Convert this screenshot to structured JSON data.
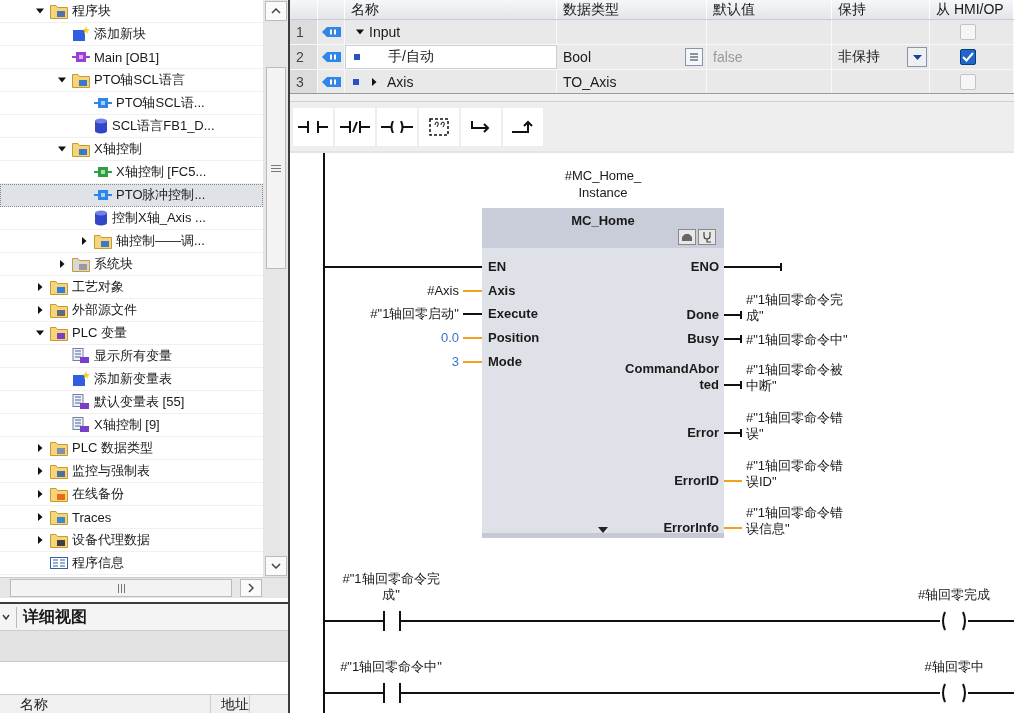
{
  "project_tree": {
    "items": [
      {
        "label": "程序块",
        "kind": "program_blocks",
        "expanded": true,
        "selected": false,
        "children": [
          {
            "label": "添加新块",
            "kind": "add_block",
            "selected": false
          },
          {
            "label": "Main [OB1]",
            "kind": "ob",
            "selected": false
          },
          {
            "label": "PTO轴SCL语言",
            "kind": "group",
            "expanded": true,
            "selected": false,
            "children": [
              {
                "label": "PTO轴SCL语...",
                "kind": "fb",
                "selected": false
              },
              {
                "label": "SCL语言FB1_D...",
                "kind": "db",
                "selected": false
              }
            ]
          },
          {
            "label": "X轴控制",
            "kind": "group",
            "expanded": true,
            "selected": false,
            "children": [
              {
                "label": "X轴控制 [FC5...",
                "kind": "fc",
                "selected": false
              },
              {
                "label": "PTO脉冲控制...",
                "kind": "fb",
                "selected": true
              },
              {
                "label": "控制X轴_Axis ...",
                "kind": "db",
                "selected": false
              },
              {
                "label": "轴控制——调...",
                "kind": "group",
                "expanded": false,
                "selected": false
              }
            ]
          },
          {
            "label": "系统块",
            "kind": "system_blocks",
            "expanded": false,
            "selected": false
          }
        ]
      },
      {
        "label": "工艺对象",
        "kind": "technology_objects",
        "expanded": false,
        "selected": false
      },
      {
        "label": "外部源文件",
        "kind": "external_sources",
        "expanded": false,
        "selected": false
      },
      {
        "label": "PLC 变量",
        "kind": "plc_tags",
        "expanded": true,
        "selected": false,
        "children": [
          {
            "label": "显示所有变量",
            "kind": "show_tags",
            "selected": false
          },
          {
            "label": "添加新变量表",
            "kind": "add_table",
            "selected": false
          },
          {
            "label": "默认变量表 [55]",
            "kind": "tag_table",
            "selected": false
          },
          {
            "label": "X轴控制 [9]",
            "kind": "tag_table",
            "selected": false
          }
        ]
      },
      {
        "label": "PLC 数据类型",
        "kind": "data_types",
        "expanded": false,
        "selected": false
      },
      {
        "label": "监控与强制表",
        "kind": "watch_tables",
        "expanded": false,
        "selected": false
      },
      {
        "label": "在线备份",
        "kind": "online_backups",
        "expanded": false,
        "selected": false
      },
      {
        "label": "Traces",
        "kind": "traces",
        "expanded": false,
        "selected": false
      },
      {
        "label": "设备代理数据",
        "kind": "device_proxy",
        "expanded": false,
        "selected": false
      },
      {
        "label": "程序信息",
        "kind": "program_info",
        "selected": false
      }
    ]
  },
  "details_view": {
    "title": "详细视图",
    "columns": [
      "名称",
      "地址"
    ]
  },
  "interface_table": {
    "columns": [
      "名称",
      "数据类型",
      "默认值",
      "保持",
      "从 HMI/OP"
    ],
    "rows": [
      {
        "number": "1",
        "kind": "section",
        "name": "Input",
        "expanded": true,
        "selected": false,
        "hmi_accessible": false
      },
      {
        "number": "2",
        "kind": "parameter",
        "name": "手/自动",
        "data_type": "Bool",
        "default_value": "false",
        "retain": "非保持",
        "selected": true,
        "hmi_accessible": true
      },
      {
        "number": "3",
        "kind": "parameter",
        "name": "Axis",
        "expanded": false,
        "data_type": "TO_Axis",
        "selected": false,
        "hmi_accessible": false
      }
    ]
  },
  "ladder": {
    "block": {
      "instance": "#MC_Home_Instance",
      "name": "MC_Home",
      "inputs": [
        {
          "pin": "EN",
          "boolean": true
        },
        {
          "pin": "Axis",
          "operand": "#Axis",
          "constant": false,
          "boolean": false
        },
        {
          "pin": "Execute",
          "operand": "#\"1轴回零启动\"",
          "constant": false,
          "boolean": true
        },
        {
          "pin": "Position",
          "operand": "0.0",
          "constant": true,
          "boolean": false
        },
        {
          "pin": "Mode",
          "operand": "3",
          "constant": true,
          "boolean": false
        }
      ],
      "outputs": [
        {
          "pin": "ENO",
          "boolean": true
        },
        {
          "pin": "Done",
          "operand": "#\"1轴回零命令完成\"",
          "boolean": true
        },
        {
          "pin": "Busy",
          "operand": "#\"1轴回零命令中\"",
          "boolean": true
        },
        {
          "pin": "CommandAborted",
          "operand": "#\"1轴回零命令被中断\"",
          "boolean": true
        },
        {
          "pin": "Error",
          "operand": "#\"1轴回零命令错误\"",
          "boolean": true
        },
        {
          "pin": "ErrorID",
          "operand": "#\"1轴回零命令错误ID\"",
          "boolean": false
        },
        {
          "pin": "ErrorInfo",
          "operand": "#\"1轴回零命令错误信息\"",
          "boolean": false
        }
      ]
    },
    "networks": [
      {
        "contact": "#\"1轴回零命令完成\"",
        "coil": "#轴回零完成"
      },
      {
        "contact": "#\"1轴回零命令中\"",
        "coil": "#轴回零中"
      }
    ]
  }
}
